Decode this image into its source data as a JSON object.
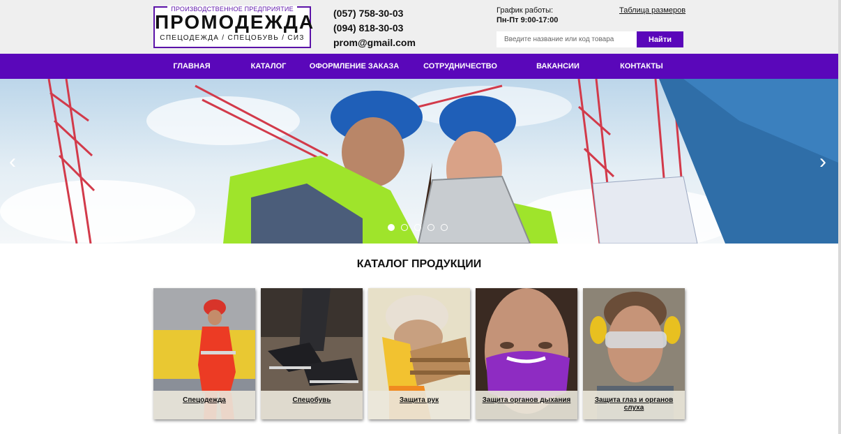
{
  "header": {
    "logo": {
      "subtitle": "ПРОИЗВОДСТВЕННОЕ ПРЕДПРИЯТИЕ",
      "title": "ПРОМОДЕЖДА",
      "tagline": "СПЕЦОДЕЖДА / СПЕЦОБУВЬ / СИЗ"
    },
    "phones": [
      "(057) 758-30-03",
      "(094) 818-30-03"
    ],
    "email": "prom@gmail.com",
    "schedule_label": "График работы:",
    "schedule_hours": "Пн-Пт 9:00-17:00",
    "sizes_link": "Таблица размеров",
    "search": {
      "placeholder": "Введите название или код товара",
      "button": "Найти"
    }
  },
  "nav": {
    "items": [
      {
        "label": "ГЛАВНАЯ"
      },
      {
        "label": "КАТАЛОГ"
      },
      {
        "label": "ОФОРМЛЕНИЕ ЗАКАЗА"
      },
      {
        "label": "СОТРУДНИЧЕСТВО"
      },
      {
        "label": "ВАКАНСИИ"
      },
      {
        "label": "КОНТАКТЫ"
      }
    ]
  },
  "slider": {
    "prev": "‹",
    "next": "›",
    "slide_count": 5,
    "active_slide": 1
  },
  "catalog": {
    "title": "КАТАЛОГ ПРОДУКЦИИ",
    "cards": [
      {
        "label": "Спецодежда"
      },
      {
        "label": "Спецобувь"
      },
      {
        "label": "Защита рук"
      },
      {
        "label": "Защита органов дыхания"
      },
      {
        "label": "Защита глаз и органов слуха"
      }
    ]
  },
  "colors": {
    "brand": "#5a07ba",
    "header_bg": "#efefef",
    "text": "#111111"
  }
}
